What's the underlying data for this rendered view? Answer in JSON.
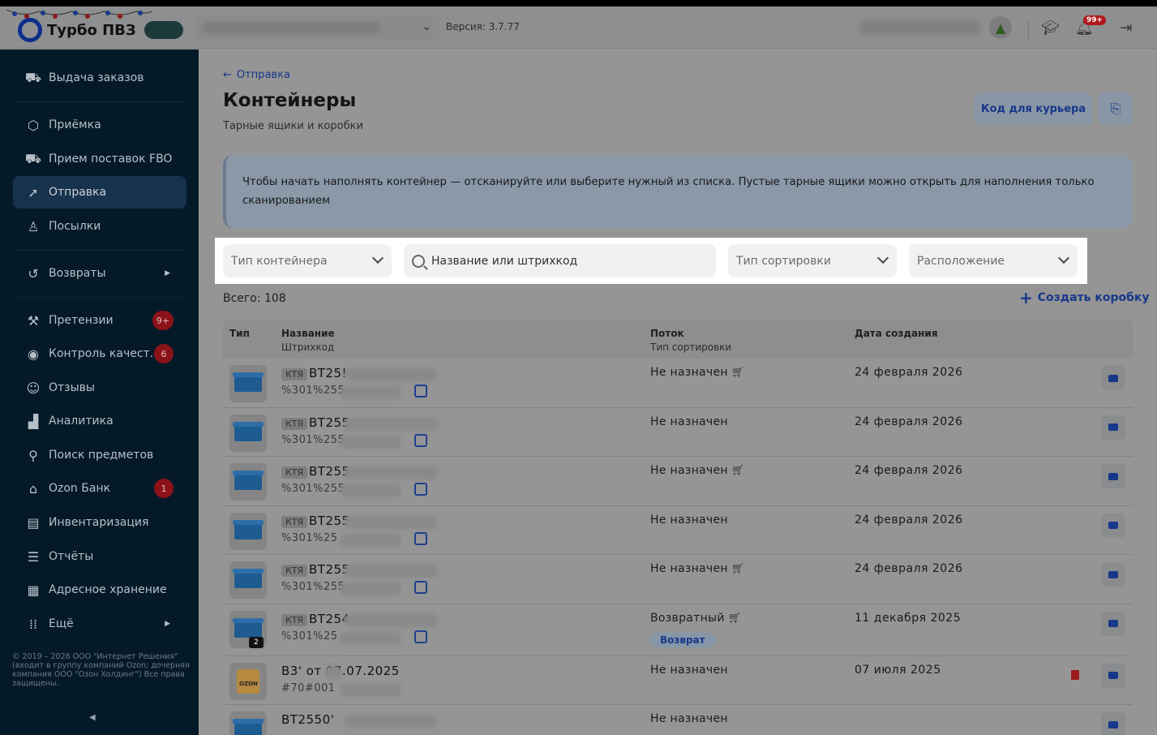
{
  "header": {
    "logo_text": "Турбо ПВЗ",
    "version": "Версия: 3.7.77",
    "notif_badge": "99+"
  },
  "sidebar": {
    "items": [
      {
        "label": "Выдача заказов",
        "icon": "handover-icon"
      },
      {
        "label": "Приёмка",
        "icon": "box-icon"
      },
      {
        "label": "Прием поставок FBO",
        "icon": "truck-icon"
      },
      {
        "label": "Отправка",
        "icon": "send-icon",
        "active": true
      },
      {
        "label": "Посылки",
        "icon": "person-icon"
      },
      {
        "label": "Возвраты",
        "icon": "return-icon",
        "has_arrow": true
      },
      {
        "label": "Претензии",
        "icon": "gavel-icon",
        "count": "9+"
      },
      {
        "label": "Контроль качест...",
        "icon": "eye-icon",
        "count": "6"
      },
      {
        "label": "Отзывы",
        "icon": "chat-icon"
      },
      {
        "label": "Аналитика",
        "icon": "chart-icon"
      },
      {
        "label": "Поиск предметов",
        "icon": "search-icon"
      },
      {
        "label": "Ozon Банк",
        "icon": "bank-icon",
        "count": "1"
      },
      {
        "label": "Инвентаризация",
        "icon": "clipboard-icon"
      },
      {
        "label": "Отчёты",
        "icon": "report-icon"
      },
      {
        "label": "Адресное хранение",
        "icon": "warehouse-icon"
      },
      {
        "label": "Ещё",
        "icon": "grid-icon",
        "has_arrow": true
      }
    ],
    "copyright": "© 2019 – 2026 ООО \"Интернет Решения\" (входит в группу компаний Ozon; дочерняя компания ООО \"Озон Холдинг\") Все права защищены."
  },
  "main": {
    "back_label": "Отправка",
    "title": "Контейнеры",
    "subtitle": "Тарные ящики и коробки",
    "courier_button": "Код для курьера",
    "info_text": "Чтобы начать наполнять контейнер — отсканируйте или выберите нужный из списка. Пустые тарные ящики можно открыть для наполнения только сканированием",
    "filters": {
      "container_type": "Тип контейнера",
      "search_placeholder": "Название или штрихкод",
      "sort_type": "Тип сортировки",
      "location": "Расположение"
    },
    "total": "Всего: 108",
    "create_label": "Создать коробку",
    "columns": {
      "type": "Тип",
      "name": "Название",
      "barcode": "Штрихкод",
      "flow": "Поток",
      "sort_type": "Тип сортировки",
      "created": "Дата создания"
    },
    "rows": [
      {
        "tag": "КТЯ",
        "name": "BT25!",
        "barcode": "%301%255",
        "flow": "Не назначен",
        "cart": true,
        "date": "24 февраля 2026",
        "kind": "blue"
      },
      {
        "tag": "КТЯ",
        "name": "BT255",
        "barcode": "%301%255",
        "flow": "Не назначен",
        "cart": false,
        "date": "24 февраля 2026",
        "kind": "blue"
      },
      {
        "tag": "КТЯ",
        "name": "BT255",
        "barcode": "%301%255",
        "flow": "Не назначен",
        "cart": true,
        "date": "24 февраля 2026",
        "kind": "blue"
      },
      {
        "tag": "КТЯ",
        "name": "BT255",
        "barcode": "%301%25",
        "flow": "Не назначен",
        "cart": false,
        "date": "24 февраля 2026",
        "kind": "blue"
      },
      {
        "tag": "КТЯ",
        "name": "BT255",
        "barcode": "%301%255",
        "flow": "Не назначен",
        "cart": true,
        "date": "24 февраля 2026",
        "kind": "blue"
      },
      {
        "tag": "КТЯ",
        "name": "BT254",
        "barcode": "%301%25",
        "flow": "Возвратный",
        "cart": true,
        "pill": "Возврат",
        "date": "11 декабря 2025",
        "kind": "blue",
        "count": "2"
      },
      {
        "tag": "",
        "name": "B3",
        "name_suffix": "' от 07.07.2025",
        "barcode": "#70#001",
        "flow": "Не назначен",
        "cart": false,
        "date": "07 июля 2025",
        "kind": "kraft",
        "kraft_label": "OZON",
        "trash": true
      },
      {
        "tag": "",
        "name": "BT2550'",
        "barcode": "",
        "flow": "Не назначен",
        "cart": false,
        "date": "",
        "kind": "blue"
      }
    ]
  }
}
